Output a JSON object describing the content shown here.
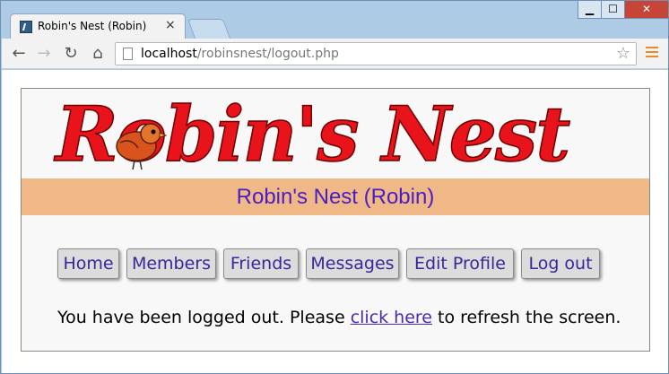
{
  "window": {
    "tab_title": "Robin's Nest (Robin)",
    "tab_close": "×"
  },
  "controls": {
    "minimize": "▁",
    "maximize": "☐",
    "close": "✕"
  },
  "toolbar": {
    "back": "←",
    "forward": "→",
    "reload": "↻",
    "home": "⌂",
    "url_host": "localhost",
    "url_path": "/robinsnest/logout.php",
    "star": "☆"
  },
  "site": {
    "logo_text": "Robin's Nest",
    "header": "Robin's Nest (Robin)",
    "menu": [
      "Home",
      "Members",
      "Friends",
      "Messages",
      "Edit Profile",
      "Log out"
    ],
    "message_before": "You have been logged out. Please ",
    "message_link": "click here",
    "message_after": " to refresh the screen."
  },
  "colors": {
    "header_bar": "#efb886",
    "header_text": "#4a1ec6",
    "logo": "#e8131b",
    "menu_text": "#3a2699"
  }
}
